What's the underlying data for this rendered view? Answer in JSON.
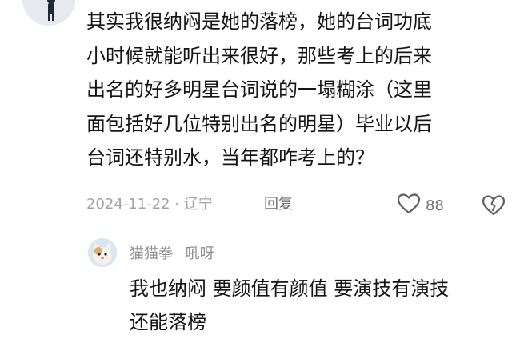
{
  "comment": {
    "lines": [
      "其实我很纳闷是她的落榜，她的台词功底",
      "小时候就能听出来很好，那些考上的后来",
      "出名的好多明星台词说的一塌糊涂（这里",
      "面包括好几位特别出名的明星）毕业以后",
      "台词还特别水，当年都咋考上的？"
    ],
    "date": "2024-11-22",
    "separator": "·",
    "location": "辽宁",
    "reply_label": "回复",
    "likes": "88"
  },
  "reply": {
    "username": "猫猫拳",
    "tag": "吼呀",
    "lines": [
      "我也纳闷 要颜值有颜值 要演技有演技",
      "还能落榜"
    ]
  },
  "icons": {
    "avatar_main": "user-avatar",
    "like": "heart-outline-icon",
    "dislike": "broken-heart-icon",
    "avatar_reply": "cat-avatar"
  },
  "colors": {
    "text": "#141414",
    "meta": "#a3a3a3",
    "icon": "#6b6b6b"
  }
}
